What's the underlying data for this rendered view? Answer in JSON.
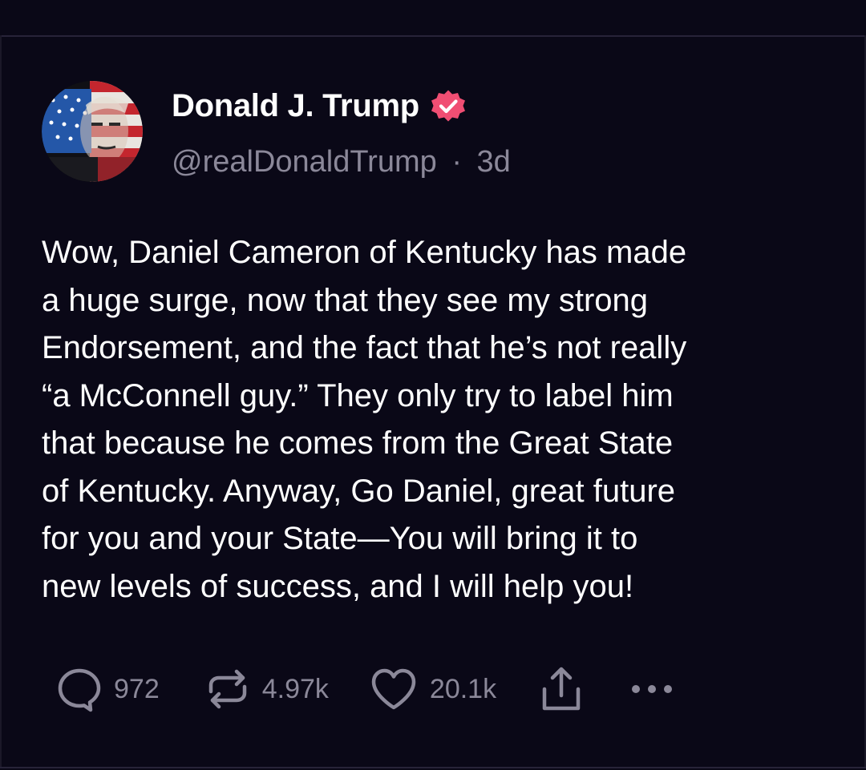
{
  "post": {
    "author": {
      "display_name": "Donald J. Trump",
      "handle": "@realDonaldTrump",
      "time": "3d",
      "separator": "·",
      "verified_icon": "verified-badge-icon",
      "verified_color": "#f04e73"
    },
    "body_lines": [
      "Wow, Daniel Cameron of Kentucky has made",
      "a huge surge, now that they see my strong",
      "Endorsement, and the fact that he’s not really",
      "“a McConnell guy.” They only try to label him",
      "that because he comes from the Great State",
      "of Kentucky. Anyway, Go Daniel, great future",
      "for you and your State—You will bring it to",
      "new levels of success, and I will help you!"
    ],
    "actions": {
      "replies": {
        "icon": "comment-icon",
        "count": "972"
      },
      "reposts": {
        "icon": "repost-icon",
        "count": "4.97k"
      },
      "likes": {
        "icon": "heart-icon",
        "count": "20.1k"
      },
      "share": {
        "icon": "share-icon"
      },
      "more": {
        "icon": "more-icon"
      }
    }
  },
  "colors": {
    "background": "#0a0817",
    "text": "#ffffff",
    "muted": "#8b8899",
    "border": "#272338"
  }
}
